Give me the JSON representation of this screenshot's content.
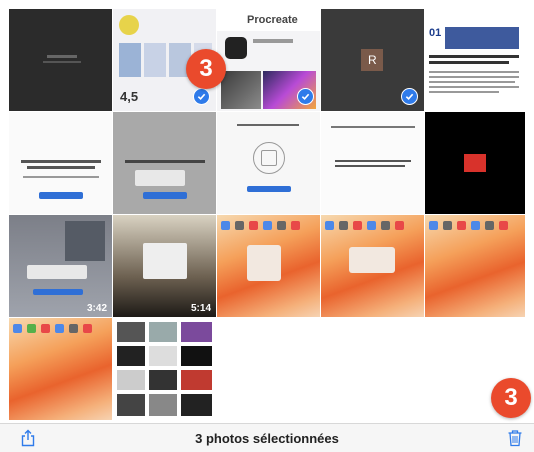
{
  "selection": {
    "status_text": "3 photos sélectionnées",
    "badge_count": "3",
    "tile_badge": "3"
  },
  "tiles": {
    "procreate_app_name": "Procreate",
    "app_rating": "4,5",
    "r_avatar_letter": "R",
    "article_logo": "01",
    "video_duration_1": "3:42",
    "video_duration_2": "5:14"
  },
  "colors": {
    "accent_badge": "#ea4a2c",
    "selection_check": "#2f7bea",
    "toolbar_icon": "#2f7bea"
  },
  "icons": {
    "share": "share-icon",
    "trash": "trash-icon",
    "check": "checkmark-icon"
  }
}
